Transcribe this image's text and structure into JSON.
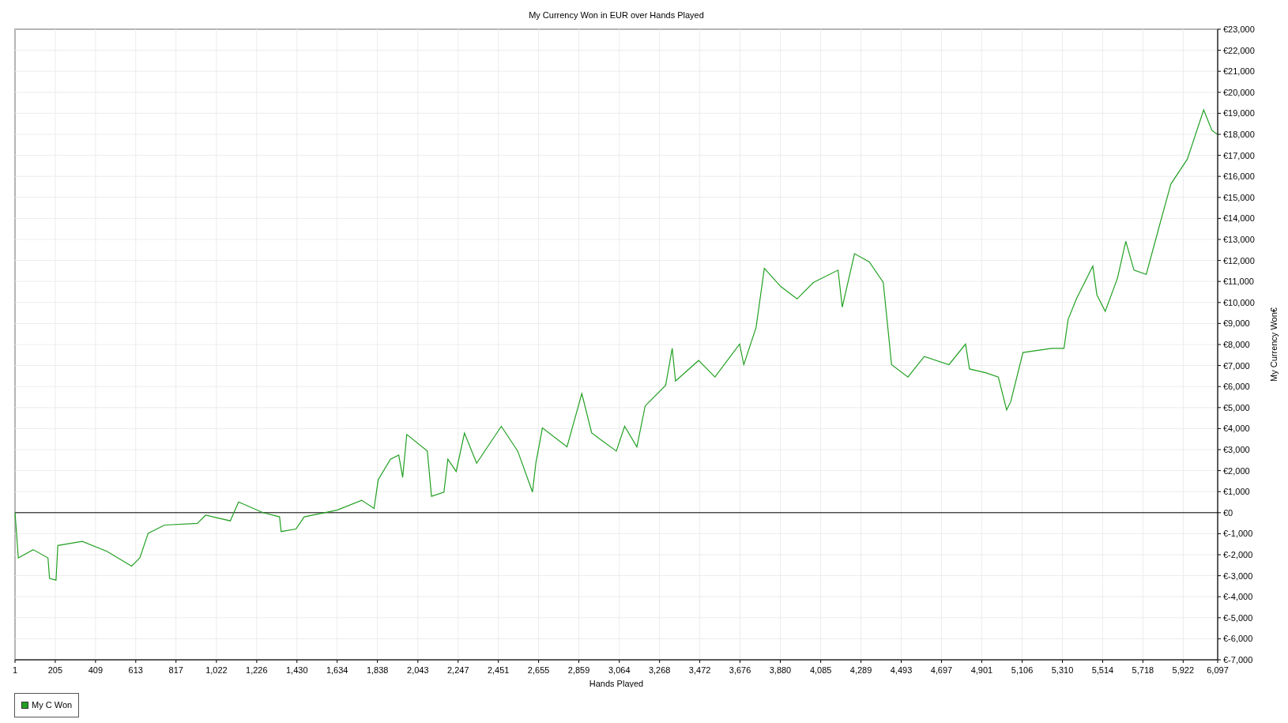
{
  "chart": {
    "chart_data": {
      "type": "line",
      "title": "My Currency Won in EUR over Hands Played",
      "xlabel": "Hands Played",
      "ylabel": "My Currency Won€",
      "x": [
        1,
        18,
        93,
        168,
        176,
        209,
        218,
        342,
        467,
        592,
        634,
        676,
        759,
        925,
        967,
        1092,
        1134,
        1258,
        1342,
        1350,
        1425,
        1467,
        1633,
        1758,
        1821,
        1842,
        1904,
        1946,
        1966,
        1987,
        2091,
        2112,
        2175,
        2195,
        2237,
        2279,
        2341,
        2466,
        2549,
        2624,
        2641,
        2674,
        2799,
        2874,
        2924,
        3049,
        3091,
        3153,
        3195,
        3299,
        3332,
        3349,
        3466,
        3549,
        3674,
        3695,
        3757,
        3799,
        3882,
        3965,
        4048,
        4173,
        4194,
        4256,
        4331,
        4402,
        4444,
        4527,
        4610,
        4735,
        4819,
        4839,
        4923,
        4985,
        5027,
        5048,
        5110,
        5256,
        5318,
        5339,
        5381,
        5464,
        5485,
        5527,
        5589,
        5631,
        5673,
        5735,
        5797,
        5860,
        5943,
        6026,
        6068,
        6097
      ],
      "series": [
        {
          "name": "My C Won",
          "color": "#22a022",
          "values": [
            0,
            -2150,
            -1760,
            -2150,
            -3130,
            -3210,
            -1560,
            -1370,
            -1840,
            -2540,
            -2150,
            -980,
            -590,
            -510,
            -120,
            -390,
            510,
            0,
            -200,
            -900,
            -780,
            -200,
            120,
            590,
            200,
            1560,
            2540,
            2740,
            1680,
            3720,
            2930,
            780,
            980,
            2540,
            1960,
            3790,
            2350,
            4110,
            2930,
            980,
            2350,
            4030,
            3130,
            5670,
            3790,
            2930,
            4110,
            3130,
            5080,
            6060,
            7820,
            6260,
            7240,
            6450,
            8020,
            7040,
            8800,
            11620,
            10760,
            10170,
            10950,
            11540,
            9780,
            12320,
            11930,
            10950,
            7040,
            6450,
            7430,
            7040,
            8020,
            6840,
            6650,
            6450,
            4890,
            5280,
            7620,
            7820,
            7820,
            9190,
            10170,
            11730,
            10360,
            9580,
            11150,
            12910,
            11540,
            11340,
            13490,
            15640,
            16820,
            19160,
            18180,
            17990
          ]
        }
      ],
      "grid": true,
      "xlim": [
        1,
        6097
      ],
      "ylim": [
        -7000,
        23000
      ],
      "xticks": [
        {
          "value": 1,
          "label": "1"
        },
        {
          "value": 205,
          "label": "205"
        },
        {
          "value": 409,
          "label": "409"
        },
        {
          "value": 613,
          "label": "613"
        },
        {
          "value": 817,
          "label": "817"
        },
        {
          "value": 1022,
          "label": "1,022"
        },
        {
          "value": 1226,
          "label": "1,226"
        },
        {
          "value": 1430,
          "label": "1,430"
        },
        {
          "value": 1634,
          "label": "1,634"
        },
        {
          "value": 1838,
          "label": "1,838"
        },
        {
          "value": 2043,
          "label": "2,043"
        },
        {
          "value": 2247,
          "label": "2,247"
        },
        {
          "value": 2451,
          "label": "2,451"
        },
        {
          "value": 2655,
          "label": "2,655"
        },
        {
          "value": 2859,
          "label": "2,859"
        },
        {
          "value": 3064,
          "label": "3,064"
        },
        {
          "value": 3268,
          "label": "3,268"
        },
        {
          "value": 3472,
          "label": "3,472"
        },
        {
          "value": 3676,
          "label": "3,676"
        },
        {
          "value": 3880,
          "label": "3,880"
        },
        {
          "value": 4085,
          "label": "4,085"
        },
        {
          "value": 4289,
          "label": "4,289"
        },
        {
          "value": 4493,
          "label": "4,493"
        },
        {
          "value": 4697,
          "label": "4,697"
        },
        {
          "value": 4901,
          "label": "4,901"
        },
        {
          "value": 5106,
          "label": "5,106"
        },
        {
          "value": 5310,
          "label": "5,310"
        },
        {
          "value": 5514,
          "label": "5,514"
        },
        {
          "value": 5718,
          "label": "5,718"
        },
        {
          "value": 5922,
          "label": "5,922"
        },
        {
          "value": 6097,
          "label": "6,097"
        }
      ],
      "yticks": [
        {
          "value": -7000,
          "label": "€-7,000"
        },
        {
          "value": -6000,
          "label": "€-6,000"
        },
        {
          "value": -5000,
          "label": "€-5,000"
        },
        {
          "value": -4000,
          "label": "€-4,000"
        },
        {
          "value": -3000,
          "label": "€-3,000"
        },
        {
          "value": -2000,
          "label": "€-2,000"
        },
        {
          "value": -1000,
          "label": "€-1,000"
        },
        {
          "value": 0,
          "label": "€0"
        },
        {
          "value": 1000,
          "label": "€1,000"
        },
        {
          "value": 2000,
          "label": "€2,000"
        },
        {
          "value": 3000,
          "label": "€3,000"
        },
        {
          "value": 4000,
          "label": "€4,000"
        },
        {
          "value": 5000,
          "label": "€5,000"
        },
        {
          "value": 6000,
          "label": "€6,000"
        },
        {
          "value": 7000,
          "label": "€7,000"
        },
        {
          "value": 8000,
          "label": "€8,000"
        },
        {
          "value": 9000,
          "label": "€9,000"
        },
        {
          "value": 10000,
          "label": "€10,000"
        },
        {
          "value": 11000,
          "label": "€11,000"
        },
        {
          "value": 12000,
          "label": "€12,000"
        },
        {
          "value": 13000,
          "label": "€13,000"
        },
        {
          "value": 14000,
          "label": "€14,000"
        },
        {
          "value": 15000,
          "label": "€15,000"
        },
        {
          "value": 16000,
          "label": "€16,000"
        },
        {
          "value": 17000,
          "label": "€17,000"
        },
        {
          "value": 18000,
          "label": "€18,000"
        },
        {
          "value": 19000,
          "label": "€19,000"
        },
        {
          "value": 20000,
          "label": "€20,000"
        },
        {
          "value": 21000,
          "label": "€21,000"
        },
        {
          "value": 22000,
          "label": "€22,000"
        },
        {
          "value": 23000,
          "label": "€23,000"
        }
      ]
    }
  }
}
